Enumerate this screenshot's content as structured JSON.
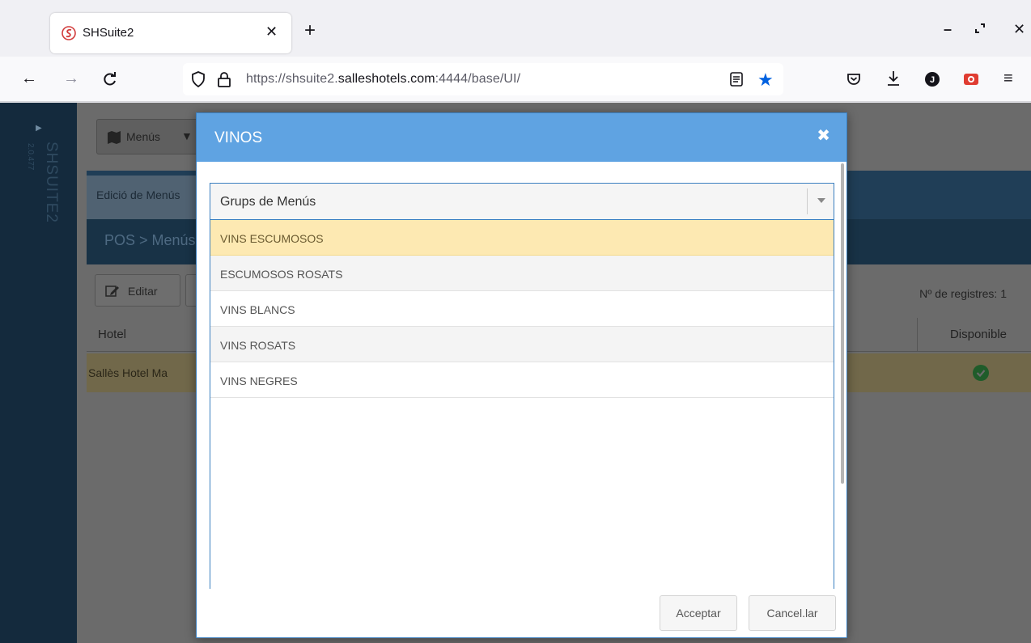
{
  "browser": {
    "tab_title": "SHSuite2",
    "url_prefix": "https://shsuite2.",
    "url_domain": "salleshotels.com",
    "url_suffix": ":4444/base/UI/"
  },
  "app": {
    "brand": "SHSUITE2",
    "version": "2.0.477",
    "menu_dropdown": "Menús",
    "edicio_tab": "Edició de Menús",
    "breadcrumb": "POS > Menús",
    "edit_button": "Editar",
    "record_count": "Nº de registres:  1",
    "table": {
      "columns": [
        "Hotel",
        "Disponible"
      ],
      "rows": [
        {
          "hotel": "Sallès Hotel Ma",
          "disponible": true
        }
      ]
    }
  },
  "modal": {
    "title": "VINOS",
    "select_label": "Grups de Menús",
    "items": [
      "VINS ESCUMOSOS",
      "ESCUMOSOS ROSATS",
      "VINS BLANCS",
      "VINS ROSATS",
      "VINS NEGRES"
    ],
    "highlighted_index": 0,
    "accept_label": "Acceptar",
    "cancel_label": "Cancel.lar"
  },
  "colors": {
    "modal_header": "#5fa3e2",
    "highlight": "#fde9b2",
    "url_star": "#0061e0"
  }
}
